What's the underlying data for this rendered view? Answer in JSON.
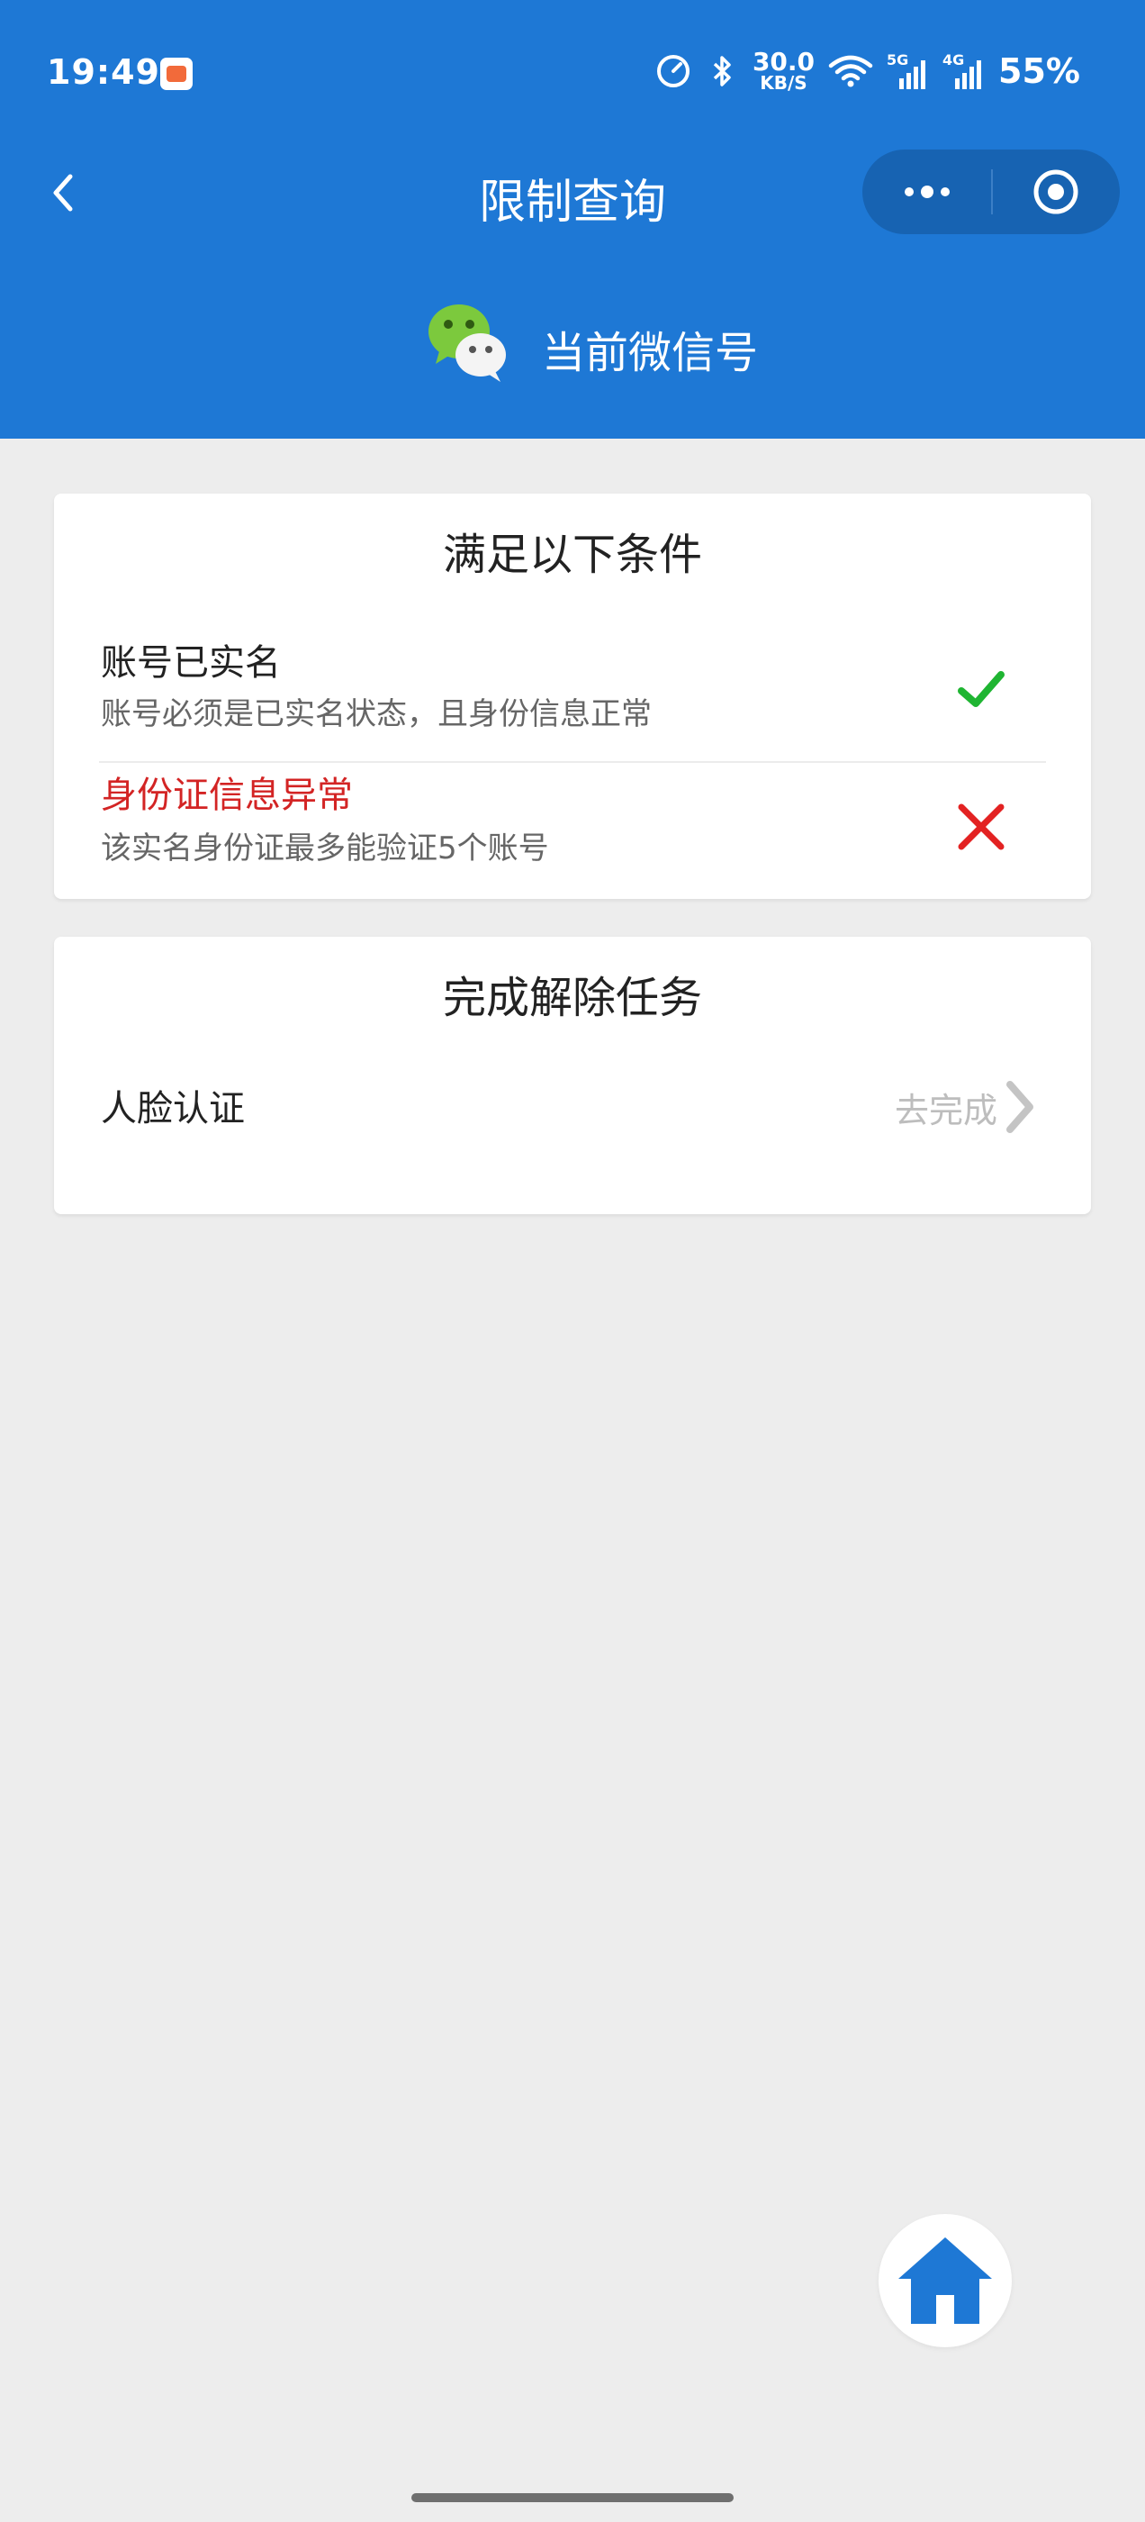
{
  "status_bar": {
    "time": "19:49",
    "net_speed_value": "30.0",
    "net_speed_unit": "KB/S",
    "signal1_label": "5G",
    "signal2_label": "4G",
    "battery": "55%",
    "icons": [
      "app-notification-icon",
      "speedometer-icon",
      "bluetooth-icon",
      "wifi-icon",
      "signal-icon",
      "signal-icon"
    ]
  },
  "nav": {
    "title": "限制查询",
    "back_icon": "chevron-left-icon",
    "more_icon": "more-dots-icon",
    "close_icon": "target-icon"
  },
  "account": {
    "icon": "wechat-icon",
    "label": "当前微信号"
  },
  "conditions_card": {
    "title": "满足以下条件",
    "items": [
      {
        "title": "账号已实名",
        "desc": "账号必须是已实名状态，且身份信息正常",
        "status": "pass",
        "icon": "check-icon",
        "color": "#1fb532"
      },
      {
        "title": "身份证信息异常",
        "desc": "该实名身份证最多能验证5个账号",
        "status": "fail",
        "icon": "cross-icon",
        "color": "#e32222"
      }
    ]
  },
  "tasks_card": {
    "title": "完成解除任务",
    "items": [
      {
        "label": "人脸认证",
        "action": "去完成",
        "icon": "chevron-right-icon"
      }
    ]
  },
  "home_button": {
    "icon": "home-icon"
  },
  "colors": {
    "primary": "#1e78d5",
    "background": "#ededed",
    "alert": "#d32424",
    "success": "#1fb532"
  }
}
